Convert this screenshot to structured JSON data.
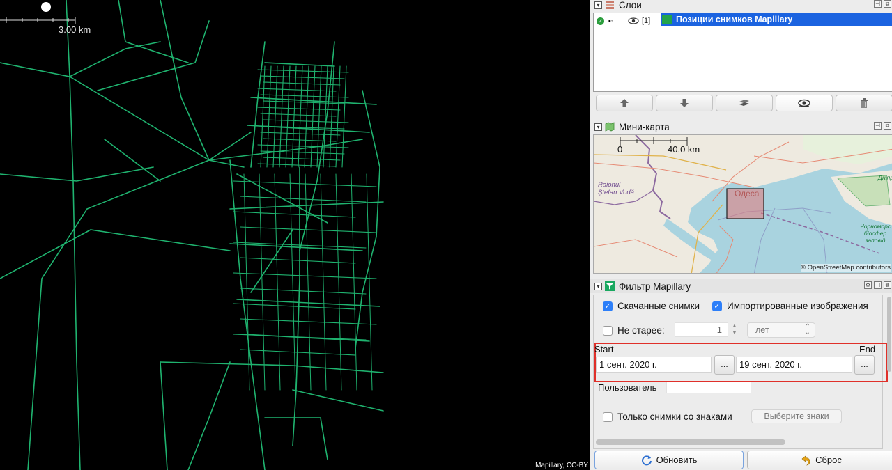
{
  "map": {
    "scale_label": "3.00 km",
    "attribution": "Mapillary, CC-BY",
    "road_color": "#1fb36f"
  },
  "layers": {
    "title": "Слои",
    "layer_index": "[1]",
    "layer_name": "Позиции снимков Mapillary",
    "icons": [
      "visible-check-icon",
      "eye-icon",
      "mapillary-layer-icon"
    ],
    "buttons": [
      "move-up-icon",
      "move-down-icon",
      "merge-icon",
      "toggle-visibility-icon",
      "delete-icon"
    ]
  },
  "minimap": {
    "title": "Мини-карта",
    "scale_start": "0",
    "scale_end": "40.0 km",
    "city": "Одеса",
    "region_label": "Raionul\nȘtefan Vodă",
    "reserve_label": "Чорноморс\nбіосфер\nзаповід",
    "river_label": "Дніпр",
    "attribution": "© OpenStreetMap contributors"
  },
  "filter": {
    "title": "Фильтр Mapillary",
    "downloaded_label": "Скачанные снимки",
    "downloaded_checked": true,
    "imported_label": "Импортированные изображения",
    "imported_checked": true,
    "not_older_label": "Не старее:",
    "not_older_checked": false,
    "not_older_value": "1",
    "not_older_unit": "лет",
    "start_label": "Start",
    "end_label": "End",
    "start_date": "1 сент. 2020 г.",
    "end_date": "19 сент. 2020 г.",
    "dots": "...",
    "user_label": "Пользователь",
    "user_value": "",
    "signs_only_label": "Только снимки со знаками",
    "signs_only_checked": false,
    "choose_signs_label": "Выберите знаки",
    "refresh_label": "Обновить",
    "reset_label": "Сброс"
  }
}
